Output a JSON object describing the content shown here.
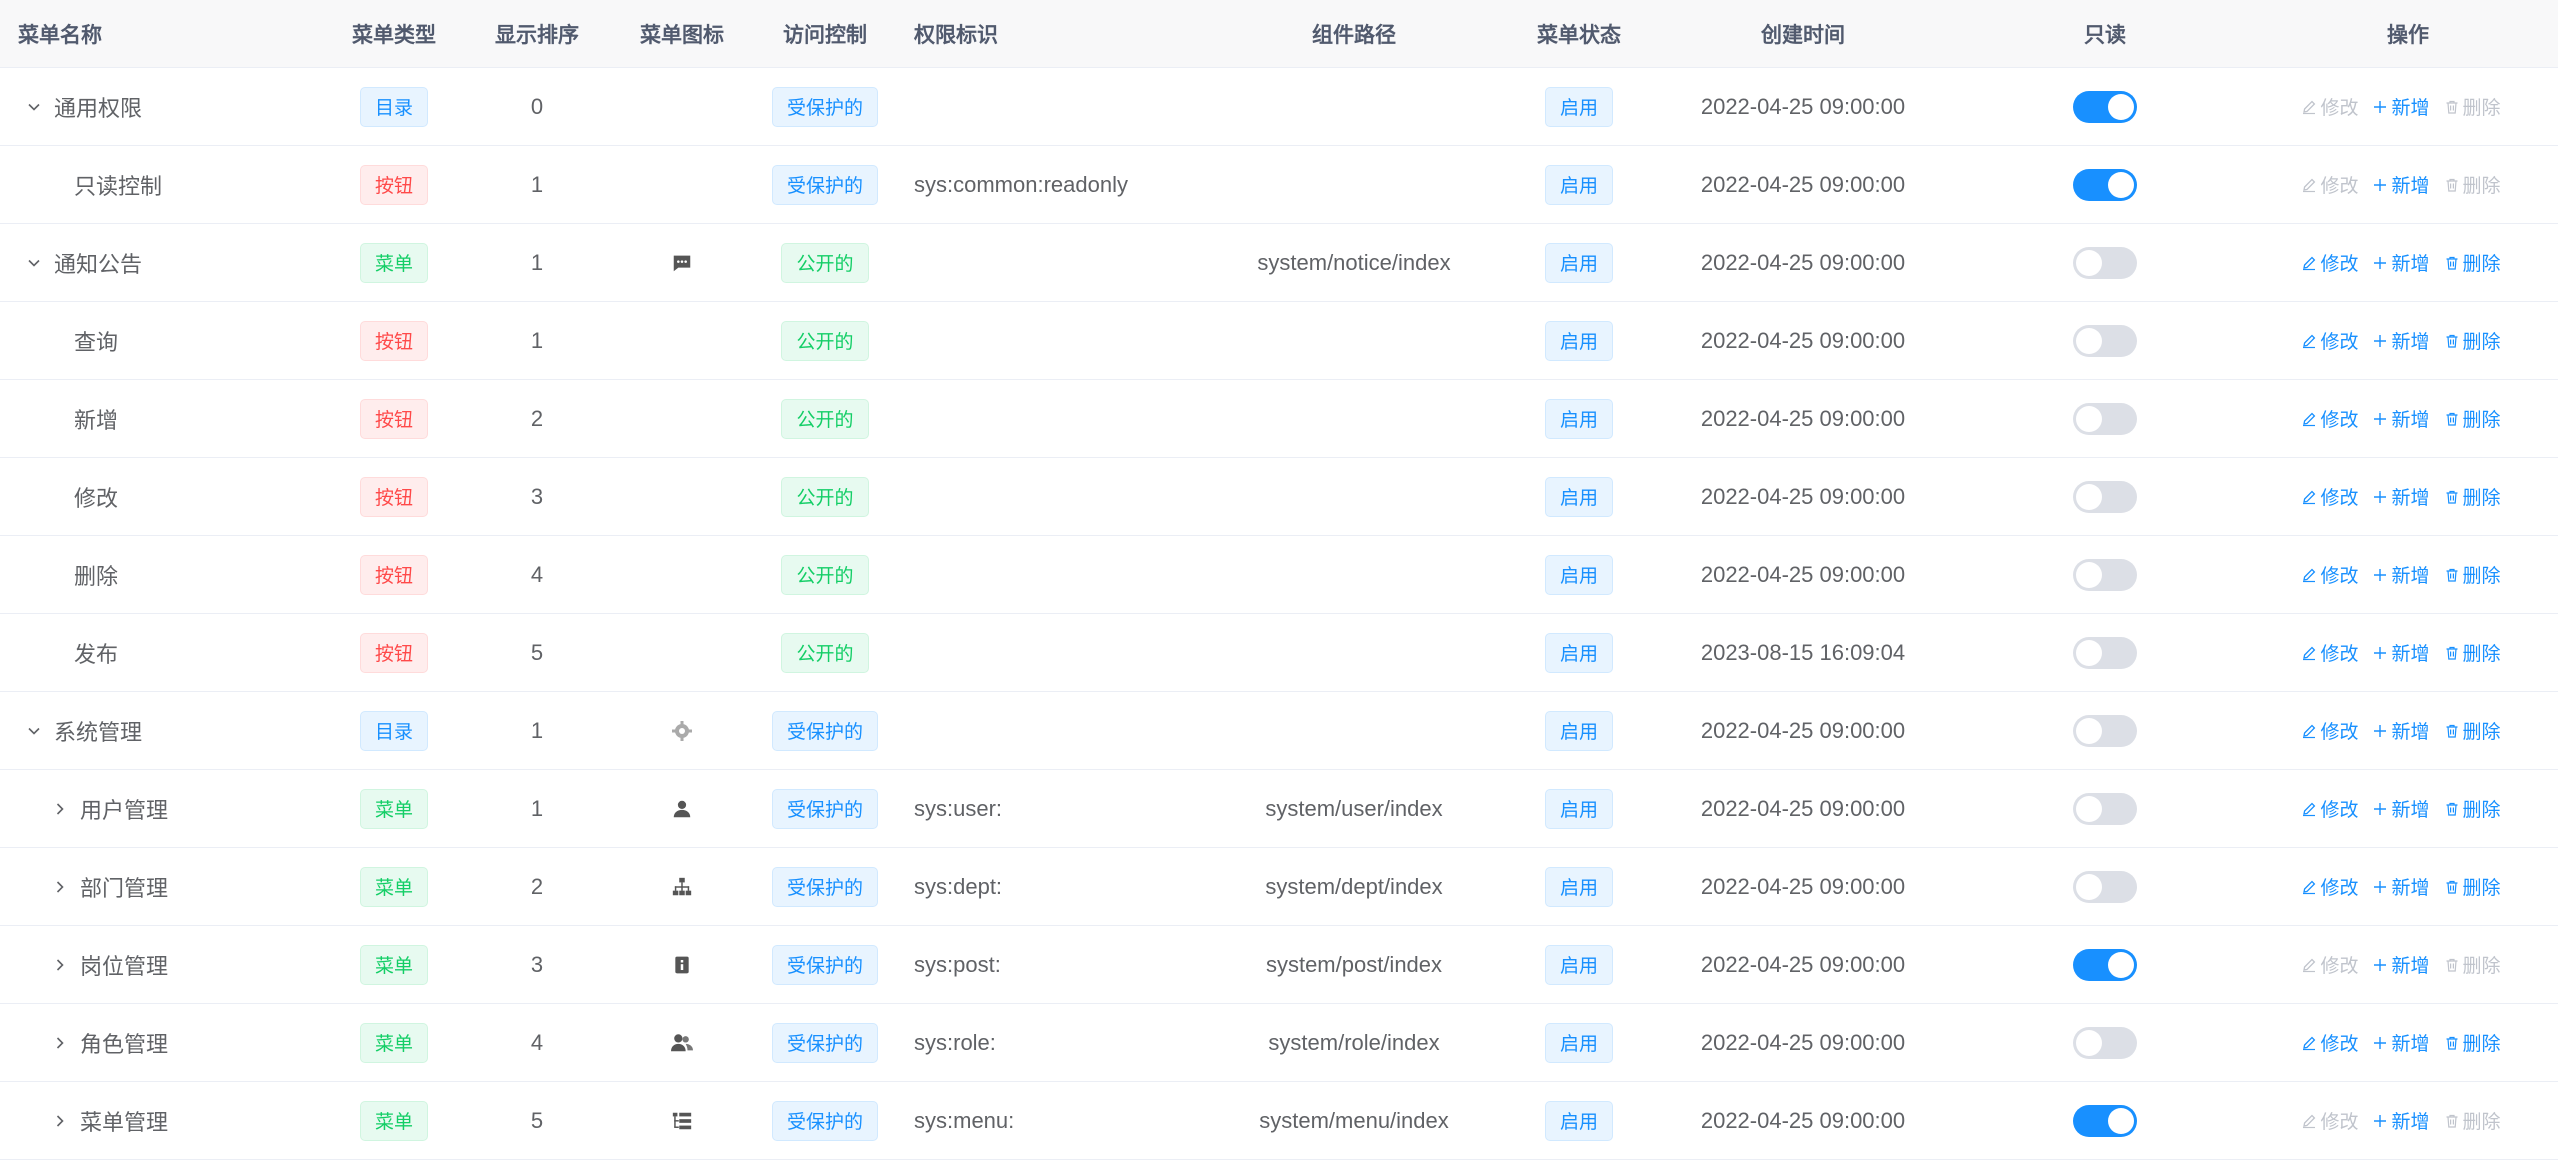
{
  "colors": {
    "accent": "#1890ff",
    "tag_blue": "#1890ff",
    "tag_green": "#13ce66",
    "tag_red": "#ff4949",
    "switch_on": "#1890ff",
    "switch_off": "#dcdfe6",
    "disabled": "#c0c4cc"
  },
  "table": {
    "headers": {
      "name": "菜单名称",
      "type": "菜单类型",
      "sort": "显示排序",
      "icon": "菜单图标",
      "access": "访问控制",
      "perm": "权限标识",
      "component": "组件路径",
      "status": "菜单状态",
      "created": "创建时间",
      "readonly": "只读",
      "ops": "操作"
    },
    "ops_labels": {
      "edit": "修改",
      "add": "新增",
      "delete": "删除"
    },
    "rows": [
      {
        "name": "通用权限",
        "level": 0,
        "caret": "expanded",
        "type": "目录",
        "type_color": "blue",
        "sort": "0",
        "icon": "",
        "access": "受保护的",
        "access_color": "blue",
        "perm": "",
        "component": "",
        "status": "启用",
        "created": "2022-04-25 09:00:00",
        "readonly": true
      },
      {
        "name": "只读控制",
        "level": 1,
        "caret": "none",
        "type": "按钮",
        "type_color": "red",
        "sort": "1",
        "icon": "",
        "access": "受保护的",
        "access_color": "blue",
        "perm": "sys:common:readonly",
        "component": "",
        "status": "启用",
        "created": "2022-04-25 09:00:00",
        "readonly": true
      },
      {
        "name": "通知公告",
        "level": 0,
        "caret": "expanded",
        "type": "菜单",
        "type_color": "green",
        "sort": "1",
        "icon": "message-icon",
        "access": "公开的",
        "access_color": "green",
        "perm": "",
        "component": "system/notice/index",
        "status": "启用",
        "created": "2022-04-25 09:00:00",
        "readonly": false
      },
      {
        "name": "查询",
        "level": 1,
        "caret": "none",
        "type": "按钮",
        "type_color": "red",
        "sort": "1",
        "icon": "",
        "access": "公开的",
        "access_color": "green",
        "perm": "",
        "component": "",
        "status": "启用",
        "created": "2022-04-25 09:00:00",
        "readonly": false
      },
      {
        "name": "新增",
        "level": 1,
        "caret": "none",
        "type": "按钮",
        "type_color": "red",
        "sort": "2",
        "icon": "",
        "access": "公开的",
        "access_color": "green",
        "perm": "",
        "component": "",
        "status": "启用",
        "created": "2022-04-25 09:00:00",
        "readonly": false
      },
      {
        "name": "修改",
        "level": 1,
        "caret": "none",
        "type": "按钮",
        "type_color": "red",
        "sort": "3",
        "icon": "",
        "access": "公开的",
        "access_color": "green",
        "perm": "",
        "component": "",
        "status": "启用",
        "created": "2022-04-25 09:00:00",
        "readonly": false
      },
      {
        "name": "删除",
        "level": 1,
        "caret": "none",
        "type": "按钮",
        "type_color": "red",
        "sort": "4",
        "icon": "",
        "access": "公开的",
        "access_color": "green",
        "perm": "",
        "component": "",
        "status": "启用",
        "created": "2022-04-25 09:00:00",
        "readonly": false
      },
      {
        "name": "发布",
        "level": 1,
        "caret": "none",
        "type": "按钮",
        "type_color": "red",
        "sort": "5",
        "icon": "",
        "access": "公开的",
        "access_color": "green",
        "perm": "",
        "component": "",
        "status": "启用",
        "created": "2023-08-15 16:09:04",
        "readonly": false
      },
      {
        "name": "系统管理",
        "level": 0,
        "caret": "expanded",
        "type": "目录",
        "type_color": "blue",
        "sort": "1",
        "icon": "gear-icon",
        "access": "受保护的",
        "access_color": "blue",
        "perm": "",
        "component": "",
        "status": "启用",
        "created": "2022-04-25 09:00:00",
        "readonly": false
      },
      {
        "name": "用户管理",
        "level": 1,
        "caret": "collapsed",
        "type": "菜单",
        "type_color": "green",
        "sort": "1",
        "icon": "user-icon",
        "access": "受保护的",
        "access_color": "blue",
        "perm": "sys:user:",
        "component": "system/user/index",
        "status": "启用",
        "created": "2022-04-25 09:00:00",
        "readonly": false
      },
      {
        "name": "部门管理",
        "level": 1,
        "caret": "collapsed",
        "type": "菜单",
        "type_color": "green",
        "sort": "2",
        "icon": "tree-org-icon",
        "access": "受保护的",
        "access_color": "blue",
        "perm": "sys:dept:",
        "component": "system/dept/index",
        "status": "启用",
        "created": "2022-04-25 09:00:00",
        "readonly": false
      },
      {
        "name": "岗位管理",
        "level": 1,
        "caret": "collapsed",
        "type": "菜单",
        "type_color": "green",
        "sort": "3",
        "icon": "post-icon",
        "access": "受保护的",
        "access_color": "blue",
        "perm": "sys:post:",
        "component": "system/post/index",
        "status": "启用",
        "created": "2022-04-25 09:00:00",
        "readonly": true
      },
      {
        "name": "角色管理",
        "level": 1,
        "caret": "collapsed",
        "type": "菜单",
        "type_color": "green",
        "sort": "4",
        "icon": "peoples-icon",
        "access": "受保护的",
        "access_color": "blue",
        "perm": "sys:role:",
        "component": "system/role/index",
        "status": "启用",
        "created": "2022-04-25 09:00:00",
        "readonly": false
      },
      {
        "name": "菜单管理",
        "level": 1,
        "caret": "collapsed",
        "type": "菜单",
        "type_color": "green",
        "sort": "5",
        "icon": "tree-table-icon",
        "access": "受保护的",
        "access_color": "blue",
        "perm": "sys:menu:",
        "component": "system/menu/index",
        "status": "启用",
        "created": "2022-04-25 09:00:00",
        "readonly": true
      }
    ]
  }
}
